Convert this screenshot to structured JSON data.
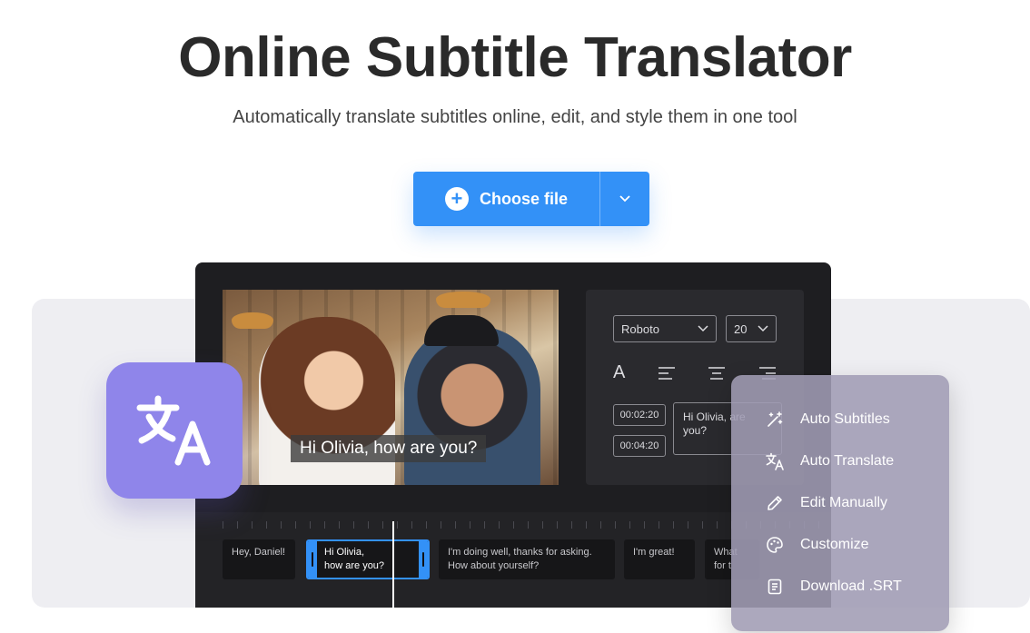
{
  "hero": {
    "title": "Online Subtitle Translator",
    "subtitle": "Automatically translate subtitles online, edit, and style them in one tool"
  },
  "choose_file": {
    "label": "Choose file",
    "plus_icon": "+",
    "color": "#3391f7"
  },
  "editor": {
    "caption": "Hi Olivia, how are you?",
    "font_select": "Roboto",
    "size_select": "20",
    "text_icon": "A",
    "time_start": "00:02:20",
    "time_end": "00:04:20",
    "subtitle_text": "Hi Olivia, are you?"
  },
  "timeline": {
    "clips": [
      {
        "text": "Hey, Daniel!"
      },
      {
        "text": "Hi Olivia,\nhow are you?"
      },
      {
        "text": "I'm doing well, thanks for asking. How about yourself?"
      },
      {
        "text": "I'm great!"
      },
      {
        "text": "What for t"
      }
    ]
  },
  "menu": {
    "items": [
      {
        "label": "Auto Subtitles",
        "icon": "magic-wand-icon"
      },
      {
        "label": "Auto Translate",
        "icon": "translate-icon"
      },
      {
        "label": "Edit Manually",
        "icon": "pencil-icon"
      },
      {
        "label": "Customize",
        "icon": "palette-icon"
      },
      {
        "label": "Download .SRT",
        "icon": "document-icon"
      }
    ]
  },
  "colors": {
    "accent": "#3391f7",
    "tile": "#8f85ea",
    "editor_bg": "#1e1e21"
  }
}
